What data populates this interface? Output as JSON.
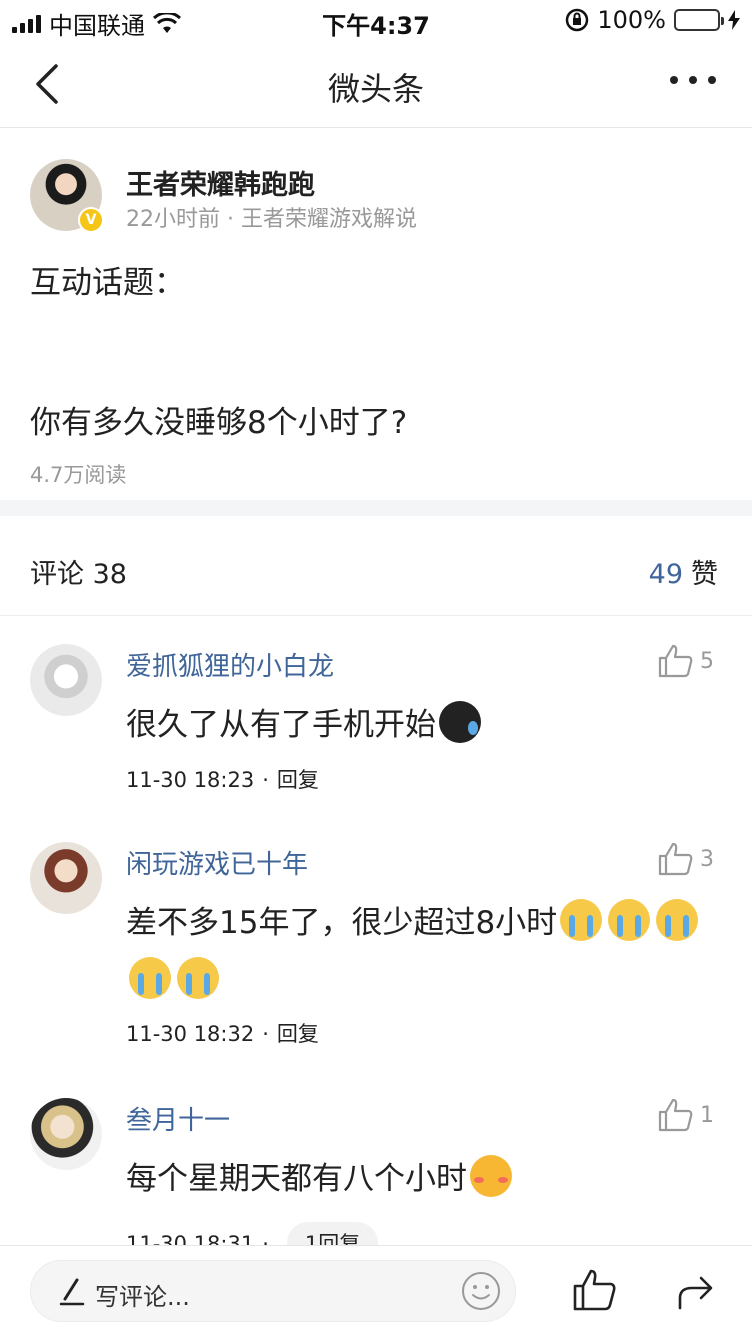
{
  "status_bar": {
    "carrier": "中国联通",
    "time": "下午4:37",
    "battery": "100%"
  },
  "nav": {
    "title": "微头条"
  },
  "post": {
    "author": "王者荣耀韩跑跑",
    "meta": "22小时前 · 王者荣耀游戏解说",
    "line1": "互动话题：",
    "line2": "你有多久没睡够8个小时了?",
    "reads": "4.7万阅读"
  },
  "stats": {
    "comments_label": "评论 38",
    "likes_count": "49",
    "likes_label": "赞"
  },
  "comments": [
    {
      "name": "爱抓狐狸的小白龙",
      "likes": "5",
      "text": "很久了从有了手机开始",
      "time": "11-30 18:23",
      "reply": "回复"
    },
    {
      "name": "闲玩游戏已十年",
      "likes": "3",
      "text": "差不多15年了，很少超过8小时",
      "time": "11-30 18:32",
      "reply": "回复"
    },
    {
      "name": "叁月十一",
      "likes": "1",
      "text": "每个星期天都有八个小时",
      "time": "11-30 18:31",
      "reply": "1回复"
    }
  ],
  "bottom_bar": {
    "placeholder": "写评论..."
  },
  "colors": {
    "link_blue": "#406599",
    "meta_gray": "#999999",
    "band_gray": "#f4f5f6"
  }
}
